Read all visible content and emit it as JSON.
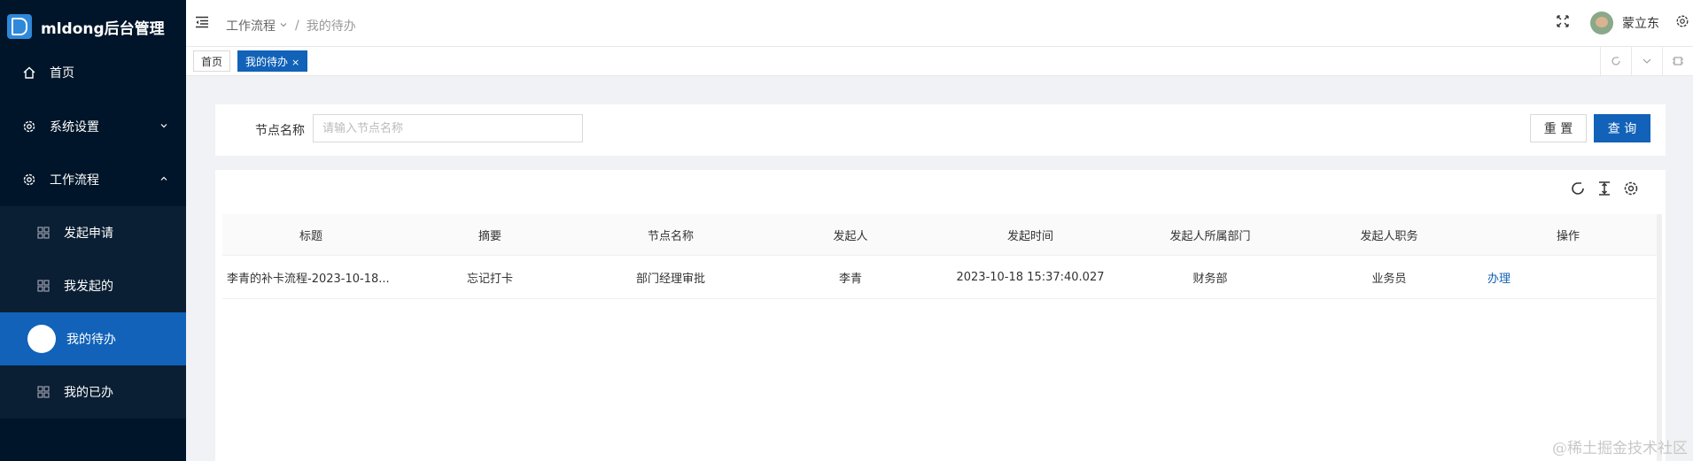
{
  "app": {
    "title": "mldong后台管理"
  },
  "sidebar": {
    "items": [
      {
        "label": "首页",
        "icon": "home-icon"
      },
      {
        "label": "系统设置",
        "icon": "gear-icon",
        "expanded": false
      },
      {
        "label": "工作流程",
        "icon": "gear-icon",
        "expanded": true
      },
      {
        "label": "发起申请",
        "icon": "grid-icon"
      },
      {
        "label": "我发起的",
        "icon": "grid-icon"
      },
      {
        "label": "我的待办",
        "icon": "circle-icon",
        "active": true
      },
      {
        "label": "我的已办",
        "icon": "grid-icon"
      }
    ]
  },
  "header": {
    "breadcrumb": [
      "工作流程",
      "我的待办"
    ],
    "username": "蒙立东"
  },
  "tabs": [
    {
      "label": "首页",
      "active": false
    },
    {
      "label": "我的待办",
      "active": true,
      "close": "×"
    }
  ],
  "search": {
    "label": "节点名称",
    "placeholder": "请输入节点名称",
    "reset_label": "重 置",
    "query_label": "查 询"
  },
  "table": {
    "columns": [
      "标题",
      "摘要",
      "节点名称",
      "发起人",
      "发起时间",
      "发起人所属部门",
      "发起人职务",
      "操作"
    ],
    "rows": [
      [
        "李青的补卡流程-2023-10-18...",
        "忘记打卡",
        "部门经理审批",
        "李青",
        "2023-10-18 15:37:40.027",
        "财务部",
        "业务员",
        "办理"
      ]
    ]
  },
  "watermark": "@稀土掘金技术社区",
  "colors": {
    "sidebar_bg": "#001529",
    "primary": "#1162b8"
  }
}
